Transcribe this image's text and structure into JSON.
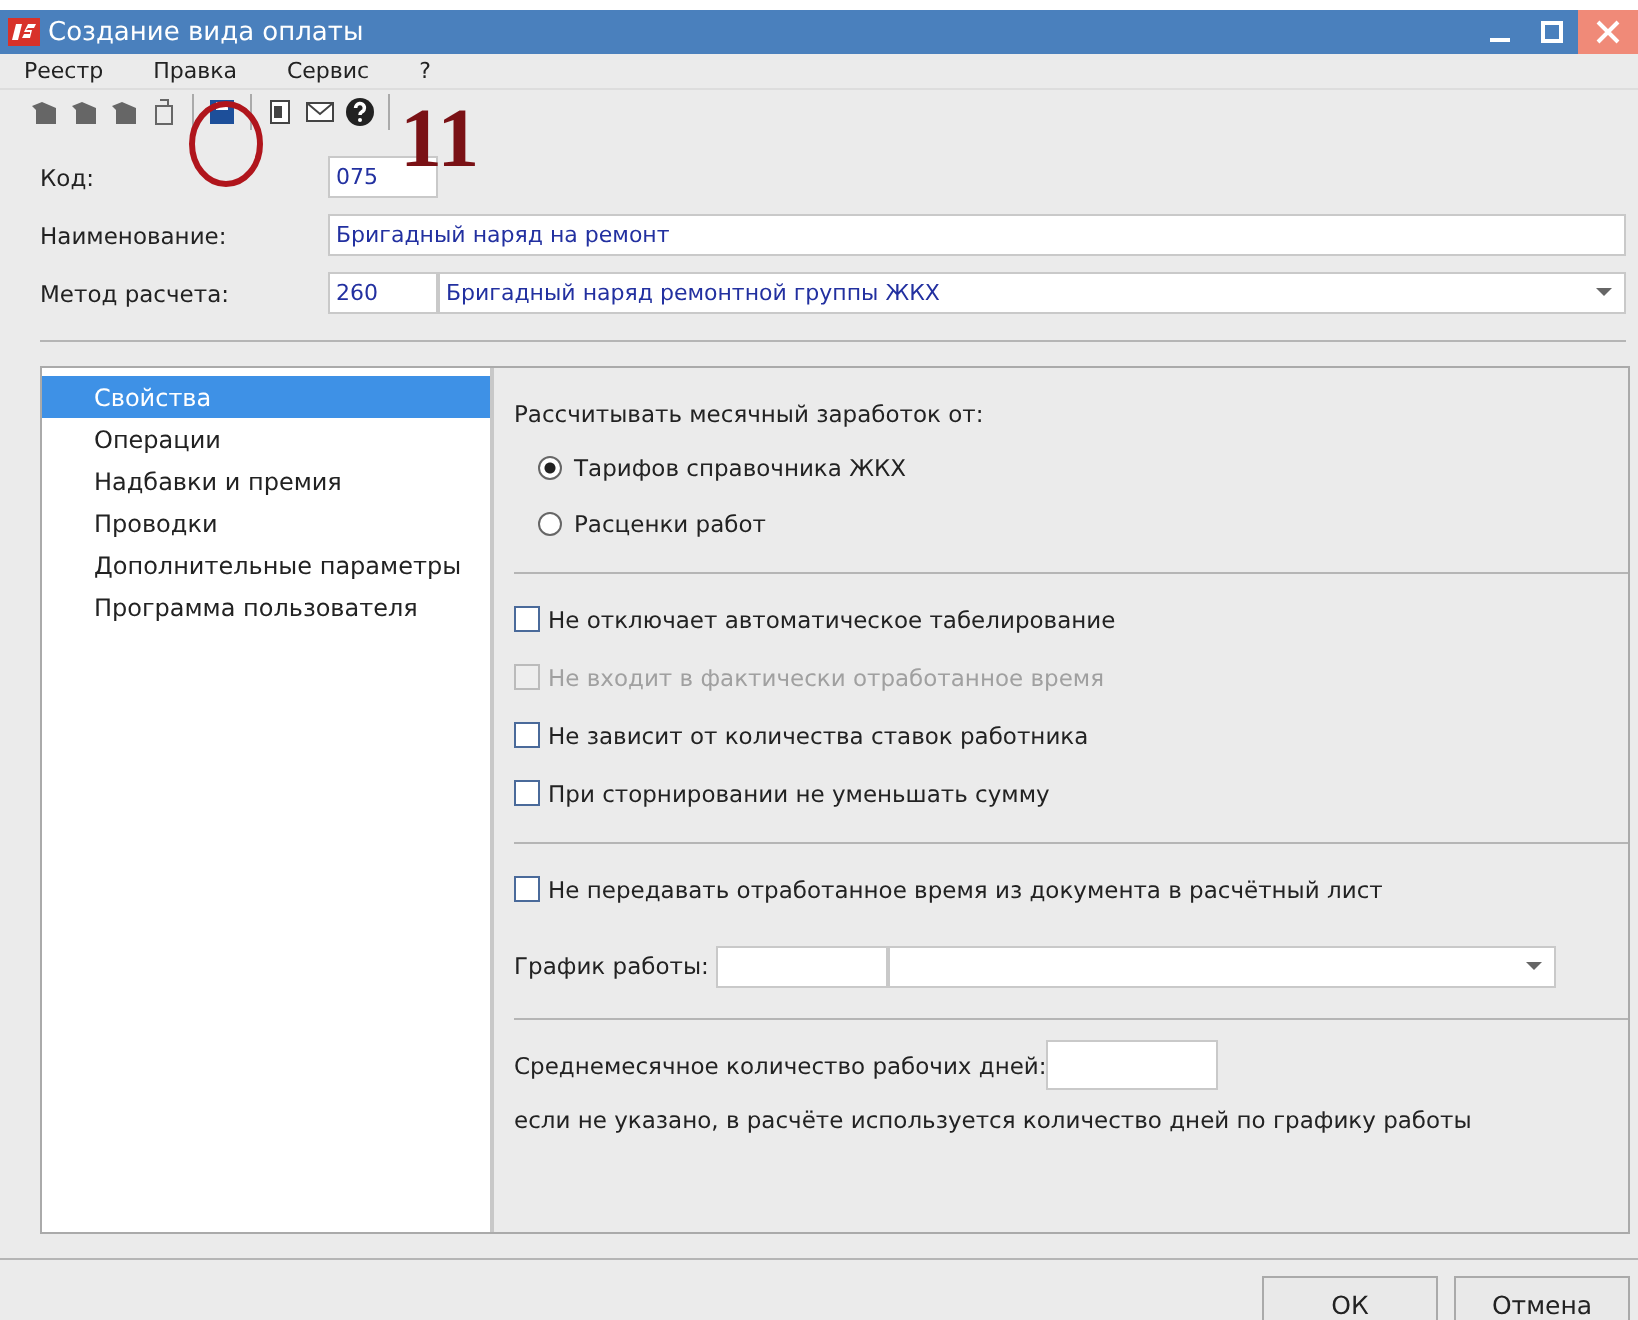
{
  "window": {
    "title": "Создание вида оплаты"
  },
  "menu": [
    {
      "label": "Реестр"
    },
    {
      "label": "Правка"
    },
    {
      "label": "Сервис"
    },
    {
      "label": "?"
    }
  ],
  "annotation": {
    "number": "11"
  },
  "fields": [
    {
      "label": "Код:",
      "code": "075"
    },
    {
      "label": "Наименование:",
      "value": "Бригадный наряд на ремонт"
    },
    {
      "label": "Метод расчета:",
      "code": "260",
      "value": "Бригадный наряд ремонтной группы ЖКХ"
    }
  ],
  "nav": [
    {
      "label": "Свойства",
      "selected": true
    },
    {
      "label": "Операции",
      "selected": false
    },
    {
      "label": "Надбавки и премия",
      "selected": false
    },
    {
      "label": "Проводки",
      "selected": false
    },
    {
      "label": "Дополнительные параметры",
      "selected": false
    },
    {
      "label": "Программа пользователя",
      "selected": false
    }
  ],
  "calc": {
    "heading": "Рассчитывать месячный заработок от:",
    "options": [
      {
        "label": "Тарифов справочника ЖКХ",
        "selected": true
      },
      {
        "label": "Расценки работ",
        "selected": false
      }
    ]
  },
  "flags": [
    {
      "label": "Не отключает автоматическое табелирование",
      "checked": false,
      "disabled": false
    },
    {
      "label": "Не входит в фактически отработанное время",
      "checked": false,
      "disabled": true
    },
    {
      "label": "Не зависит от количества ставок работника",
      "checked": false,
      "disabled": false
    },
    {
      "label": "При сторнировании не уменьшать сумму",
      "checked": false,
      "disabled": false
    }
  ],
  "transfer": {
    "label": "Не передавать отработанное время из документа в расчётный лист",
    "checked": false
  },
  "schedule": {
    "label": "График работы:"
  },
  "avg_days": {
    "label": "Среднемесячное количество рабочих дней:",
    "note": "если не указано, в расчёте используется количество дней по графику работы"
  },
  "buttons": [
    {
      "label": "ОК"
    },
    {
      "label": "Отмена"
    }
  ]
}
